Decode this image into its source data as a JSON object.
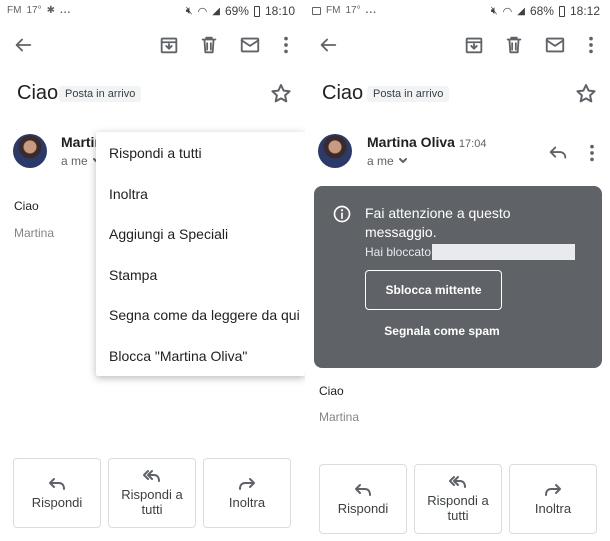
{
  "left": {
    "status": {
      "carrier": "FM",
      "temp": "17°",
      "dots": "...",
      "battery": "69%",
      "time": "18:10"
    },
    "email": {
      "subject": "Ciao",
      "label": "Posta in arrivo",
      "sender": "Martina",
      "to": "a me",
      "body_line1": "Ciao",
      "body_line2": "Martina"
    },
    "menu": {
      "items": [
        "Rispondi a tutti",
        "Inoltra",
        "Aggiungi a Speciali",
        "Stampa",
        "Segna come da leggere da qui",
        "Blocca \"Martina Oliva\""
      ]
    },
    "actions": {
      "reply": "Rispondi",
      "reply_all_1": "Rispondi a",
      "reply_all_2": "tutti",
      "forward": "Inoltra"
    }
  },
  "right": {
    "status": {
      "carrier": "FM",
      "temp": "17°",
      "dots": "...",
      "battery": "68%",
      "time": "18:12"
    },
    "email": {
      "subject": "Ciao",
      "label": "Posta in arrivo",
      "sender": "Martina Oliva",
      "time": "17:04",
      "to": "a me",
      "body_line1": "Ciao",
      "body_line2": "Martina"
    },
    "warning": {
      "title": "Fai attenzione a questo messaggio.",
      "subtitle": "Hai bloccato",
      "unblock": "Sblocca mittente",
      "spam": "Segnala come spam"
    },
    "actions": {
      "reply": "Rispondi",
      "reply_all_1": "Rispondi a",
      "reply_all_2": "tutti",
      "forward": "Inoltra"
    }
  },
  "colors": {
    "warning_card": "#5f6368",
    "chip_bg": "#f1f3f4",
    "border": "#dadce0"
  },
  "icons": [
    "back-arrow-icon",
    "archive-icon",
    "trash-icon",
    "mail-icon",
    "more-vert-icon",
    "star-icon",
    "reply-icon",
    "reply-all-icon",
    "forward-icon",
    "info-icon",
    "chevron-down-icon"
  ]
}
